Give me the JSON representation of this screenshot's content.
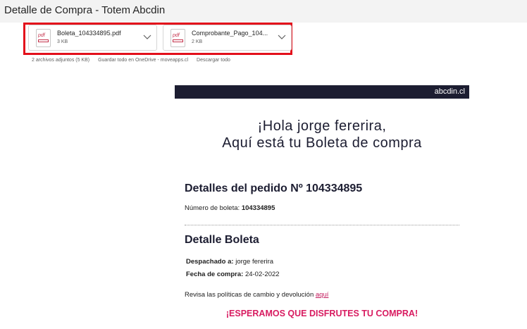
{
  "window": {
    "title": "Detalle de Compra - Totem Abcdin"
  },
  "attachments": [
    {
      "name": "Boleta_104334895.pdf",
      "size": "3 KB",
      "icon": "pdf-icon"
    },
    {
      "name": "Comprobante_Pago_104...",
      "size": "2 KB",
      "icon": "pdf-icon"
    }
  ],
  "attachment_actions": {
    "count": "2 archivos adjuntos (5 KB)",
    "save_onedrive": "Guardar todo en OneDrive - moveapps.cl",
    "download_all": "Descargar todo"
  },
  "pdf_badge": "pdf",
  "email": {
    "brand": "abcdin.cl",
    "greeting_line1": "¡Hola jorge fererira,",
    "greeting_line2": "Aquí está tu Boleta de compra",
    "order_title": "Detalles del pedido Nº 104334895",
    "receipt_label": "Número de boleta:",
    "receipt_value": "104334895",
    "detail_title": "Detalle Boleta",
    "shipped_label": "Despachado a:",
    "shipped_value": "jorge fererira",
    "date_label": "Fecha de compra:",
    "date_value": "24-02-2022",
    "policy_text": "Revisa las políticas de cambio y devolución",
    "policy_link": "aquí",
    "closing": "¡ESPERAMOS QUE DISFRUTES TU COMPRA!"
  },
  "colors": {
    "header_bg": "#1c1d31",
    "highlight": "#e3101b",
    "accent_pink": "#d81b60"
  }
}
